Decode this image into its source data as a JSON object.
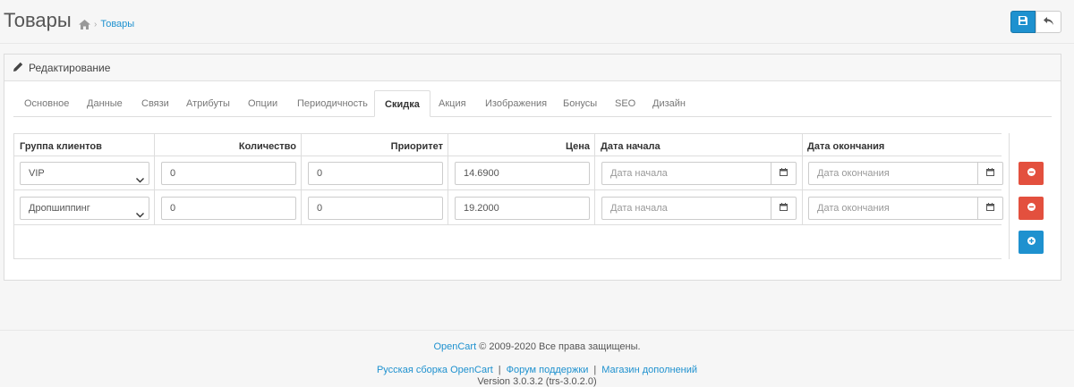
{
  "header": {
    "title": "Товары",
    "breadcrumb": [
      {
        "label": "Товары"
      }
    ]
  },
  "panel": {
    "heading": "Редактирование"
  },
  "tabs": [
    {
      "label": "Основное",
      "active": false
    },
    {
      "label": "Данные",
      "active": false
    },
    {
      "label": "Связи",
      "active": false
    },
    {
      "label": "Атрибуты",
      "active": false
    },
    {
      "label": "Опции",
      "active": false
    },
    {
      "label": "Периодичность",
      "active": false
    },
    {
      "label": "Скидка",
      "active": true
    },
    {
      "label": "Акция",
      "active": false
    },
    {
      "label": "Изображения",
      "active": false
    },
    {
      "label": "Бонусы",
      "active": false
    },
    {
      "label": "SEO",
      "active": false
    },
    {
      "label": "Дизайн",
      "active": false
    }
  ],
  "table": {
    "columns": [
      "Группа клиентов",
      "Количество",
      "Приоритет",
      "Цена",
      "Дата начала",
      "Дата окончания"
    ],
    "rows": [
      {
        "group": "VIP",
        "quantity": "0",
        "priority": "0",
        "price": "14.6900",
        "date_start": "",
        "date_end": ""
      },
      {
        "group": "Дропшиппинг",
        "quantity": "0",
        "priority": "0",
        "price": "19.2000",
        "date_start": "",
        "date_end": ""
      }
    ],
    "placeholders": {
      "date_start": "Дата начала",
      "date_end": "Дата окончания"
    }
  },
  "colors": {
    "primary": "#1e91cf",
    "danger": "#e3503e"
  },
  "footer": {
    "brand_link": "OpenCart",
    "copyright": "© 2009-2020 Все права защищены.",
    "links": [
      "Русская сборка OpenCart",
      "Форум поддержки",
      "Магазин дополнений"
    ],
    "separator": "|",
    "version": "Version 3.0.3.2 (trs-3.0.2.0)"
  }
}
